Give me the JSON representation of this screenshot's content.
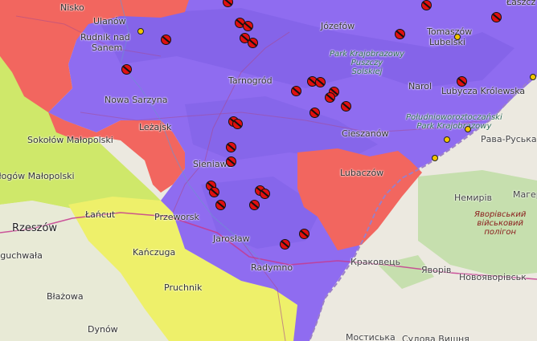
{
  "places": {
    "nisko": "Nisko",
    "ulanow": "Ulanów",
    "rudnik": "Rudnik nad",
    "rudnik2": "Sanem",
    "jozefow": "Józefów",
    "tomaszow": "Tomaszów",
    "tomaszow2": "Lubelski",
    "lasz": "Łaszcz",
    "tarnogrod": "Tarnogród",
    "narol": "Narol",
    "lubycza": "Lubycza Królewska",
    "nowa_sarzyna": "Nowa Sarzyna",
    "lezajsk": "Leżajsk",
    "cieszanow": "Cieszanów",
    "rawa": "Рава-Руська",
    "sokolow": "Sokołów Małopolski",
    "glogow": "Głogów Małopolski",
    "sieniawa": "Sieniawa",
    "lubaczow": "Lubaczów",
    "lancut": "Łańcut",
    "przeworsk": "Przeworsk",
    "rzeszow": "Rzeszów",
    "nemyriv": "Немирів",
    "mager": "Магер",
    "jaroslaw": "Jarosław",
    "kanczuga": "Kańczuga",
    "tyczyn": "Tyczyn",
    "boguchwala": "Boguchwała",
    "radymno": "Radymno",
    "krakovets": "Краковець",
    "yavoriv": "Яворів",
    "novoyavorivsk": "Новояворівськ",
    "pruchnik": "Pruchnik",
    "blazowa": "Błażowa",
    "dynow": "Dynów",
    "mostyska": "Мостиська",
    "sudova": "Судова Вишня"
  },
  "parks": {
    "puszcza_1": "Park Krajobrazowy",
    "puszcza_2": "Puszczy",
    "puszcza_3": "Solskiej",
    "roztocze_1": "Południoworoztoczański",
    "roztocze_2": "Park Krajobrazowy",
    "yavoriv_mil_1": "Яворівський",
    "yavoriv_mil_2": "військовий",
    "yavoriv_mil_3": "полігон"
  },
  "zone_colors": {
    "purple": "#8f6cf0",
    "purple_dark": "#7b5ce6",
    "red": "#f2665f",
    "yellow": "#eef06a",
    "green_yellow": "#cfe86a",
    "ukraine_base": "#ece9e0",
    "forest": "#b9d9a4"
  },
  "markers": {
    "red_crossed": "crossed-circle-icon",
    "yellow": "yellow-point-icon"
  }
}
